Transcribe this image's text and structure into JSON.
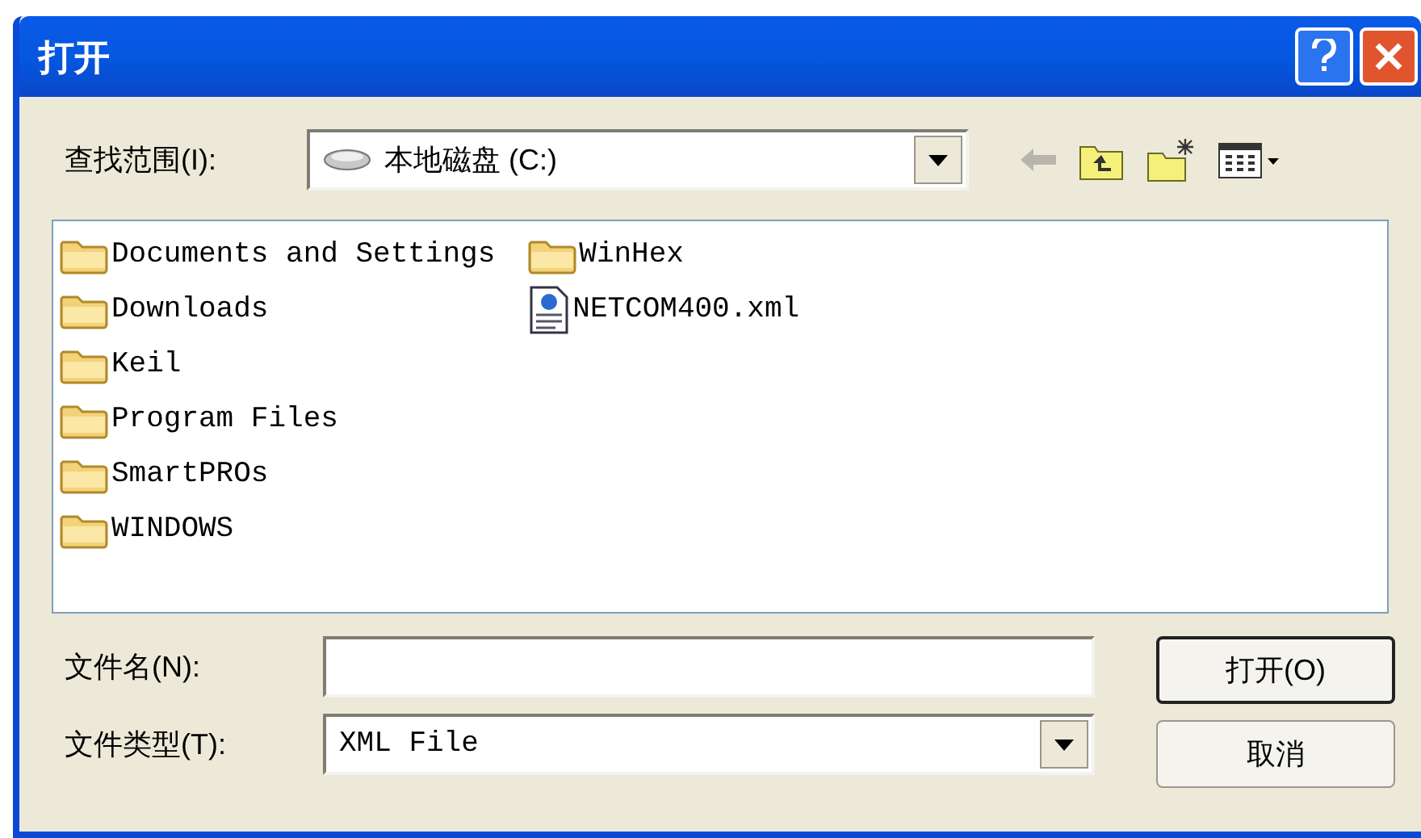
{
  "window": {
    "title": "打开"
  },
  "look_in": {
    "label": "查找范围(I):",
    "value": "本地磁盘 (C:)"
  },
  "files": [
    {
      "name": "Documents and Settings",
      "kind": "folder"
    },
    {
      "name": "Downloads",
      "kind": "folder"
    },
    {
      "name": "Keil",
      "kind": "folder"
    },
    {
      "name": "Program Files",
      "kind": "folder"
    },
    {
      "name": "SmartPROs",
      "kind": "folder"
    },
    {
      "name": "WINDOWS",
      "kind": "folder"
    },
    {
      "name": "WinHex",
      "kind": "folder"
    },
    {
      "name": "NETCOM400.xml",
      "kind": "xml"
    }
  ],
  "file_name": {
    "label": "文件名(N):"
  },
  "file_type": {
    "label": "文件类型(T):",
    "value": "XML File"
  },
  "buttons": [
    "打开(O)",
    "取消"
  ]
}
